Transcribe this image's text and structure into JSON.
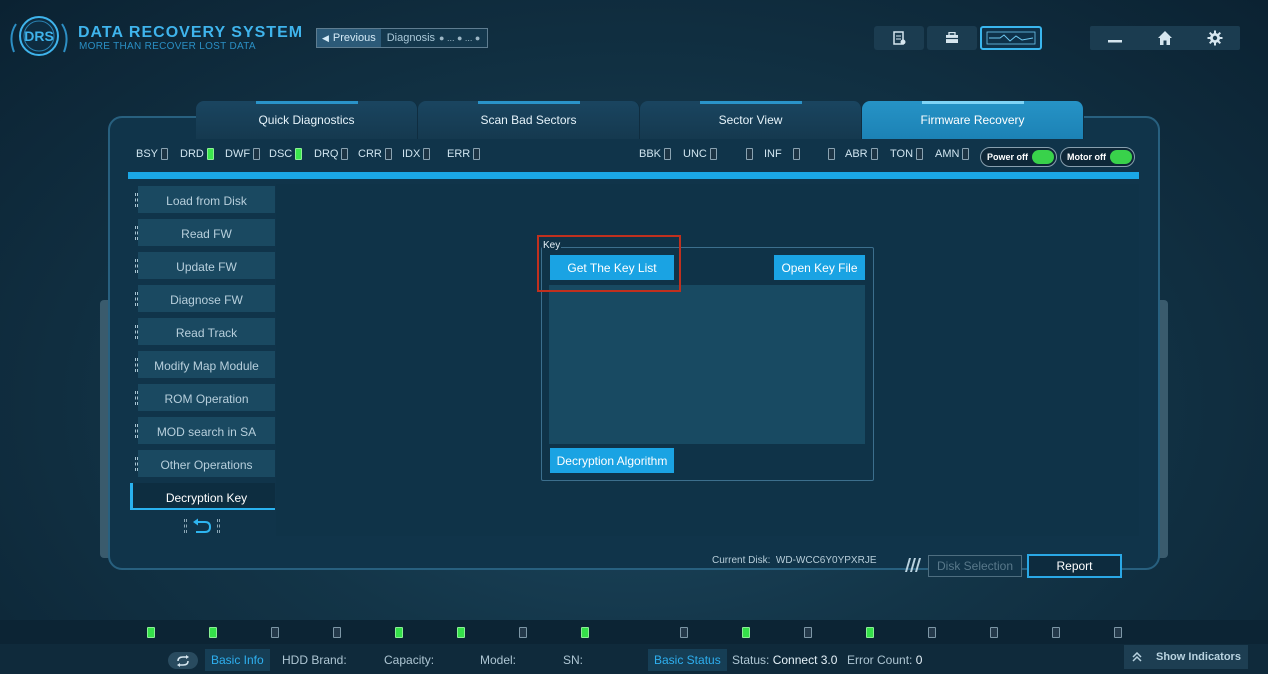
{
  "app": {
    "title": "DATA RECOVERY SYSTEM",
    "subtitle": "MORE THAN RECOVER LOST DATA",
    "logo_text": "DRS"
  },
  "nav": {
    "previous_label": "Previous",
    "breadcrumb": "Diagnosis",
    "breadcrumb_dots": "● ... ● ... ●"
  },
  "tabs": [
    {
      "label": "Quick Diagnostics",
      "active": false
    },
    {
      "label": "Scan Bad Sectors",
      "active": false
    },
    {
      "label": "Sector View",
      "active": false
    },
    {
      "label": "Firmware Recovery",
      "active": true
    }
  ],
  "indicators_left": [
    {
      "label": "BSY",
      "on": false
    },
    {
      "label": "DRD",
      "on": true
    },
    {
      "label": "DWF",
      "on": false
    },
    {
      "label": "DSC",
      "on": true
    },
    {
      "label": "DRQ",
      "on": false
    },
    {
      "label": "CRR",
      "on": false
    },
    {
      "label": "IDX",
      "on": false
    },
    {
      "label": "ERR",
      "on": false
    }
  ],
  "indicators_right": [
    {
      "label": "BBK",
      "on": false
    },
    {
      "label": "UNC",
      "on": false
    },
    {
      "label": "",
      "on": false
    },
    {
      "label": "INF",
      "on": false
    },
    {
      "label": "",
      "on": false
    },
    {
      "label": "ABR",
      "on": false
    },
    {
      "label": "TON",
      "on": false
    },
    {
      "label": "AMN",
      "on": false
    }
  ],
  "toggles": {
    "power": "Power off",
    "motor": "Motor off"
  },
  "menu": [
    {
      "label": "Load from Disk",
      "active": false
    },
    {
      "label": "Read FW",
      "active": false
    },
    {
      "label": "Update FW",
      "active": false
    },
    {
      "label": "Diagnose FW",
      "active": false
    },
    {
      "label": "Read Track",
      "active": false
    },
    {
      "label": "Modify Map Module",
      "active": false
    },
    {
      "label": "ROM Operation",
      "active": false
    },
    {
      "label": "MOD search in SA",
      "active": false
    },
    {
      "label": "Other Operations",
      "active": false
    },
    {
      "label": "Decryption Key",
      "active": true
    }
  ],
  "key_panel": {
    "group_title": "Key",
    "get_key_list": "Get The Key List",
    "open_key_file": "Open Key File",
    "decryption_algorithm": "Decryption Algorithm"
  },
  "footer": {
    "current_disk_label": "Current Disk:",
    "current_disk_value": "WD-WCC6Y0YPXRJE",
    "disk_selection": "Disk Selection",
    "report": "Report"
  },
  "bottom_leds": [
    true,
    true,
    false,
    false,
    true,
    true,
    false,
    true,
    false,
    true,
    false,
    true,
    false,
    false,
    false,
    false
  ],
  "status_bar": {
    "basic_info": "Basic Info",
    "hdd_brand": "HDD Brand:",
    "capacity": "Capacity:",
    "model": "Model:",
    "sn": "SN:",
    "basic_status": "Basic Status",
    "status_label": "Status:",
    "status_value": "Connect 3.0",
    "error_count_label": "Error Count:",
    "error_count_value": "0",
    "show_indicators": "Show Indicators"
  },
  "colors": {
    "accent": "#1aa7e6",
    "highlight": "#c0301e",
    "led_on": "#3be84d"
  }
}
